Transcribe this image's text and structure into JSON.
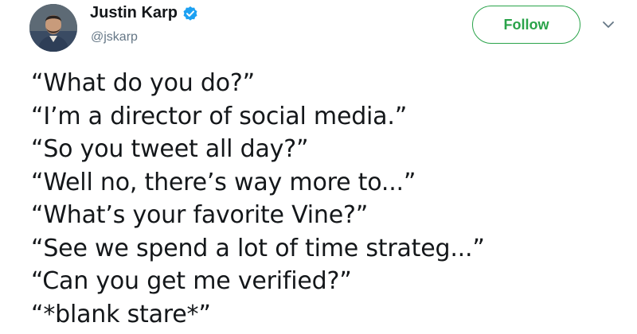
{
  "author": {
    "display_name": "Justin Karp",
    "handle": "@jskarp",
    "verified": true
  },
  "actions": {
    "follow_label": "Follow",
    "menu_icon": "chevron-down-icon"
  },
  "colors": {
    "follow_accent": "#2aa34a",
    "verified_badge": "#1da1f2",
    "handle_gray": "#657786",
    "text": "#14171a"
  },
  "tweet": {
    "lines": [
      "“What do you do?”",
      "“I’m a director of social media.”",
      "“So you tweet all day?”",
      "“Well no, there’s way more to...”",
      "“What’s your favorite Vine?”",
      "“See we spend a lot of time strateg...”",
      "“Can you get me verified?”",
      "“*blank stare*”"
    ]
  }
}
